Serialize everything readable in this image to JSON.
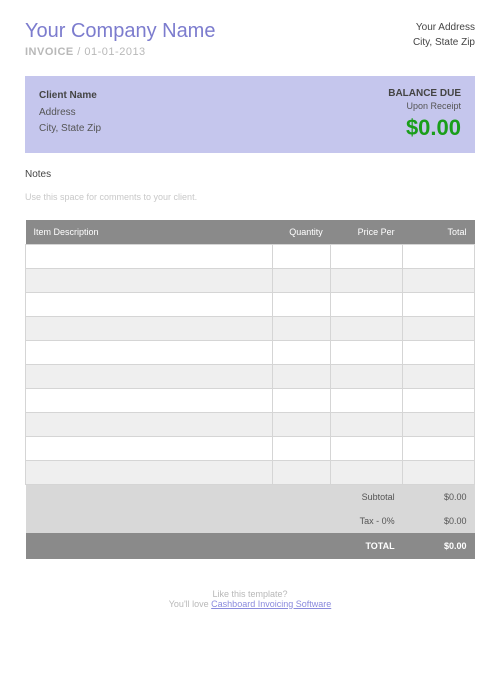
{
  "header": {
    "company_name": "Your Company Name",
    "invoice_label": "INVOICE",
    "invoice_sep": " / ",
    "invoice_date": "01-01-2013",
    "your_address": "Your Address",
    "your_city_state_zip": "City, State Zip"
  },
  "client": {
    "name": "Client Name",
    "address": "Address",
    "city_state_zip": "City, State Zip",
    "balance_label": "BALANCE DUE",
    "terms": "Upon Receipt",
    "amount": "$0.00"
  },
  "notes": {
    "title": "Notes",
    "placeholder": "Use this space for comments to your client."
  },
  "table": {
    "headers": {
      "desc": "Item Description",
      "qty": "Quantity",
      "price": "Price Per",
      "total": "Total"
    },
    "summary": {
      "subtotal_label": "Subtotal",
      "subtotal_value": "$0.00",
      "tax_label": "Tax - 0%",
      "tax_value": "$0.00",
      "total_label": "TOTAL",
      "total_value": "$0.00"
    }
  },
  "footer": {
    "line1": "Like this template?",
    "line2_pre": "You'll love ",
    "link": "Cashboard Invoicing Software"
  }
}
